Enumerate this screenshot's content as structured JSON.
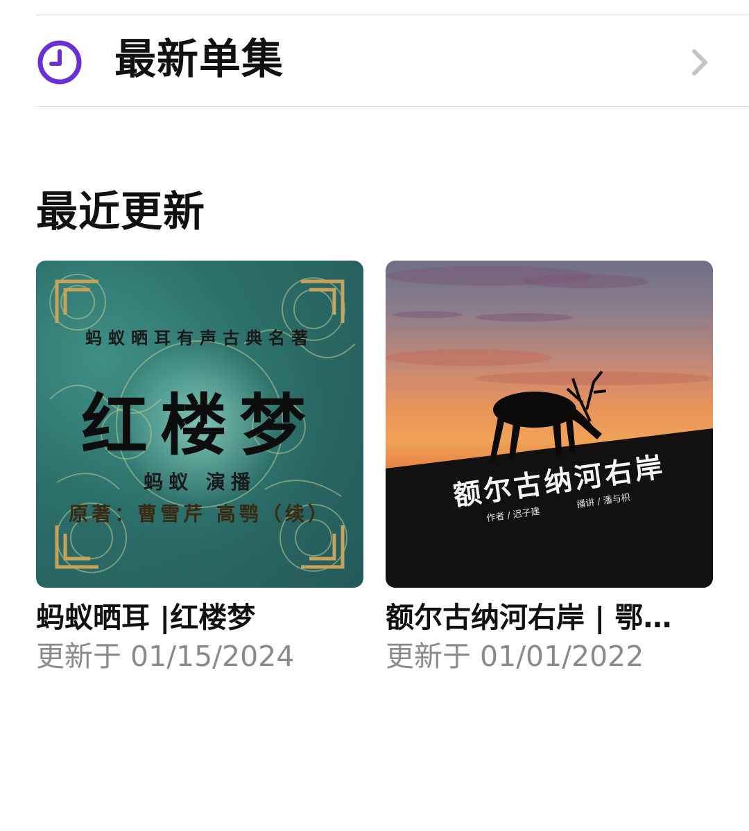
{
  "latest_episodes": {
    "label": "最新单集"
  },
  "recent_updates": {
    "title": "最近更新",
    "items": [
      {
        "title": "蚂蚁晒耳 |红楼梦",
        "updated": "更新于 01/15/2024",
        "cover": {
          "subtitle": "蚂蚁晒耳有声古典名著",
          "title": "红楼梦",
          "narrator": "蚂蚁 演播",
          "original": "原著：曹雪芹 高鹗（续）"
        }
      },
      {
        "title": "额尔古纳河右岸 | 鄂…",
        "updated": "更新于 01/01/2022",
        "cover": {
          "title": "额尔古纳河右岸",
          "author": "作者 / 迟子建",
          "narrator": "播讲 / 潘与枳"
        }
      }
    ]
  },
  "colors": {
    "accent": "#6a2fd6",
    "secondary_text": "#8a8a8e"
  },
  "icons": {
    "row_icon": "clock-icon",
    "row_chevron": "chevron-right-icon"
  }
}
